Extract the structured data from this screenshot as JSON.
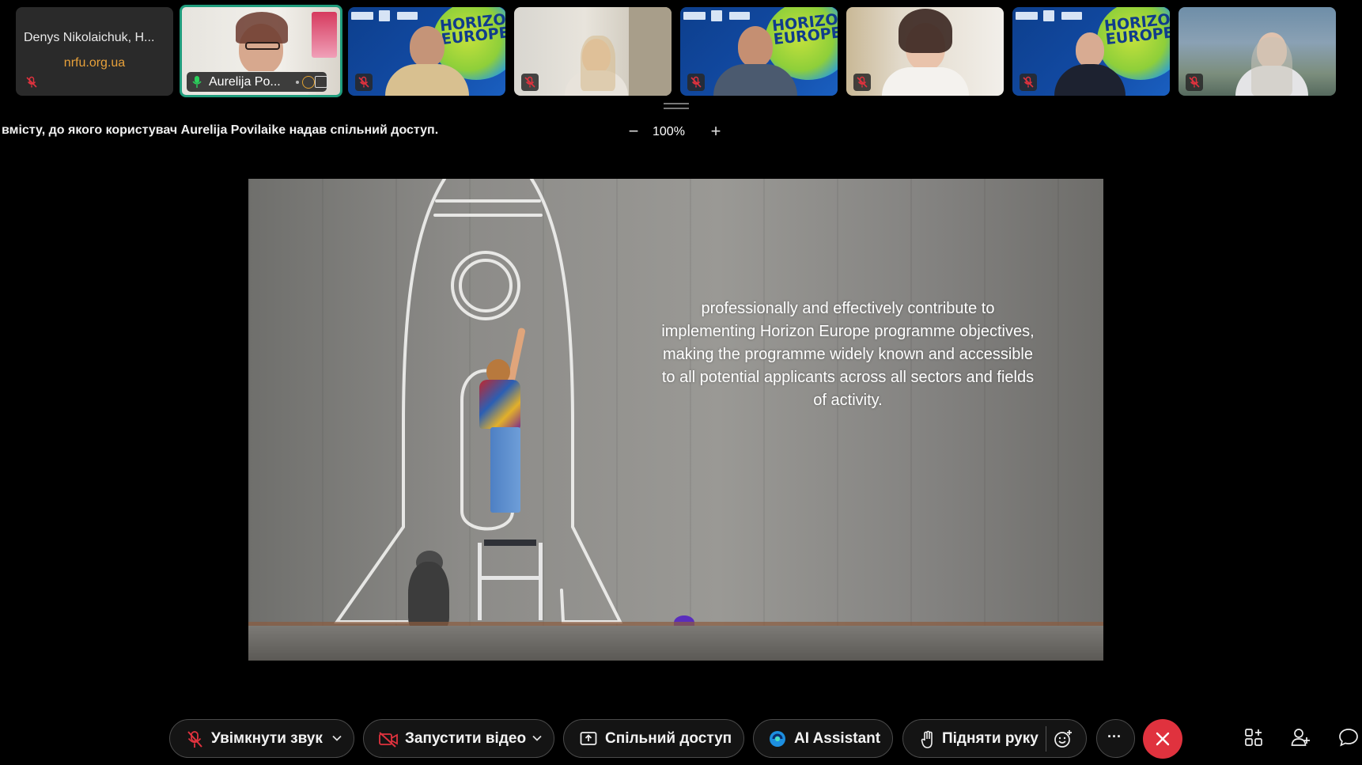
{
  "participants": [
    {
      "name": "Denys Nikolaichuk, H...",
      "org": "nrfu.org.ua",
      "muted": true
    },
    {
      "name": "Aurelija Po...",
      "active": true
    },
    {
      "muted": true,
      "background": "horizon-europe"
    },
    {
      "muted": true,
      "background": "room"
    },
    {
      "muted": true,
      "background": "horizon-europe"
    },
    {
      "muted": true,
      "background": "room"
    },
    {
      "muted": true,
      "background": "horizon-europe"
    },
    {
      "muted": true,
      "background": "mountain"
    }
  ],
  "horizon_bg_text": "HORIZON EUROPE",
  "share_message": "вмісту, до якого користувач Aurelija Povilaike надав спільний доступ.",
  "zoom": {
    "value": "100%",
    "minus": "−",
    "plus": "+"
  },
  "slide": {
    "text": "professionally and effectively contribute to implementing Horizon Europe programme objectives, making the programme widely known and accessible to all potential applicants across all sectors and fields of activity."
  },
  "toolbar": {
    "unmute_label": "Увімкнути звук",
    "start_video_label": "Запустити відео",
    "share_label": "Спільний доступ",
    "ai_assistant_label": "AI Assistant",
    "raise_hand_label": "Підняти руку",
    "more_label": "···"
  },
  "colors": {
    "active_border": "#1f9c7c",
    "org_text": "#e8a13a",
    "end_call": "#e0323e",
    "mute_icon": "#e0323e"
  },
  "icons": [
    "mic-muted-icon",
    "mic-icon",
    "video-off-icon",
    "share-screen-icon",
    "ai-assistant-icon",
    "raise-hand-icon",
    "reaction-icon",
    "more-icon",
    "close-icon",
    "apps-icon",
    "participants-icon",
    "chat-icon"
  ]
}
